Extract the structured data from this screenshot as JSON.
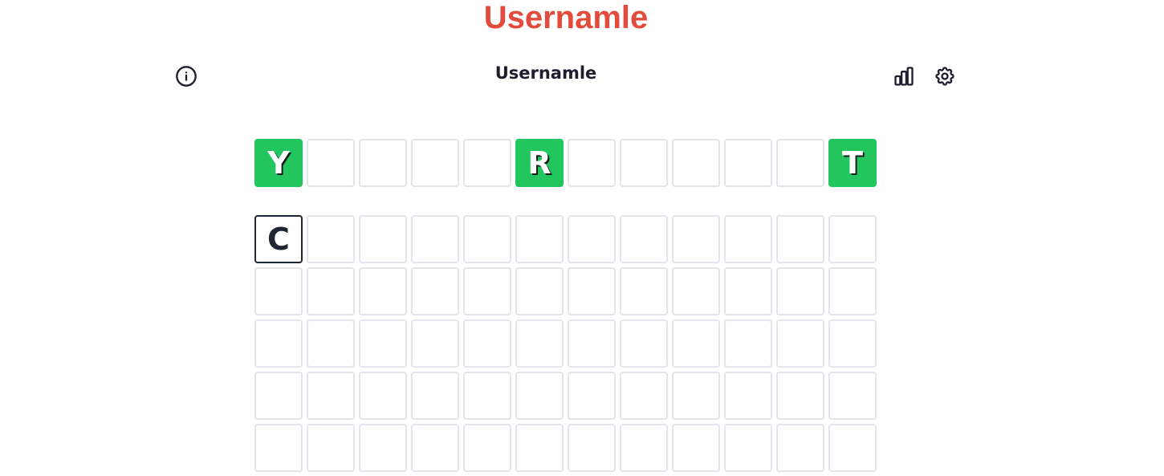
{
  "site_title": "Usernamle",
  "navbar": {
    "title": "Usernamle",
    "icons": [
      "info-icon",
      "stats-icon",
      "settings-icon"
    ]
  },
  "colors": {
    "site_title": "#e34c3c",
    "correct": "#22c55e",
    "empty_border": "#e2e5ea",
    "filled_border": "#1e2533"
  },
  "hint_row": [
    "Y",
    "",
    "",
    "",
    "",
    "R",
    "",
    "",
    "",
    "",
    "",
    "T"
  ],
  "hint_states": [
    "correct",
    "empty",
    "empty",
    "empty",
    "empty",
    "correct",
    "empty",
    "empty",
    "empty",
    "empty",
    "empty",
    "correct"
  ],
  "guess_rows": [
    [
      "C",
      "",
      "",
      "",
      "",
      "",
      "",
      "",
      "",
      "",
      "",
      ""
    ],
    [
      "",
      "",
      "",
      "",
      "",
      "",
      "",
      "",
      "",
      "",
      "",
      ""
    ],
    [
      "",
      "",
      "",
      "",
      "",
      "",
      "",
      "",
      "",
      "",
      "",
      ""
    ],
    [
      "",
      "",
      "",
      "",
      "",
      "",
      "",
      "",
      "",
      "",
      "",
      ""
    ],
    [
      "",
      "",
      "",
      "",
      "",
      "",
      "",
      "",
      "",
      "",
      "",
      ""
    ]
  ]
}
